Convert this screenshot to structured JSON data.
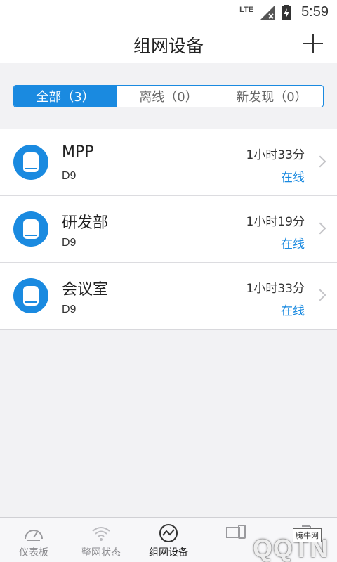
{
  "status_bar": {
    "network": "LTE",
    "time": "5:59"
  },
  "header": {
    "title": "组网设备"
  },
  "segments": [
    {
      "label": "全部（3）",
      "active": true
    },
    {
      "label": "离线（0）",
      "active": false
    },
    {
      "label": "新发现（0）",
      "active": false
    }
  ],
  "devices": [
    {
      "name": "MPP",
      "model": "D9",
      "duration": "1小时33分",
      "status": "在线"
    },
    {
      "name": "研发部",
      "model": "D9",
      "duration": "1小时19分",
      "status": "在线"
    },
    {
      "name": "会议室",
      "model": "D9",
      "duration": "1小时33分",
      "status": "在线"
    }
  ],
  "tabs": [
    {
      "label": "仪表板",
      "icon": "gauge-icon",
      "active": false
    },
    {
      "label": "整网状态",
      "icon": "wifi-icon",
      "active": false
    },
    {
      "label": "组网设备",
      "icon": "network-chart-icon",
      "active": true
    },
    {
      "label": "",
      "icon": "devices-icon",
      "active": false
    },
    {
      "label": "",
      "icon": "more-icon",
      "active": false
    }
  ],
  "watermark": {
    "tag": "腾牛网",
    "text": "QQTN"
  },
  "colors": {
    "accent": "#1a8ae0",
    "background": "#f2f2f4",
    "tab_inactive": "#8a8a8e"
  }
}
